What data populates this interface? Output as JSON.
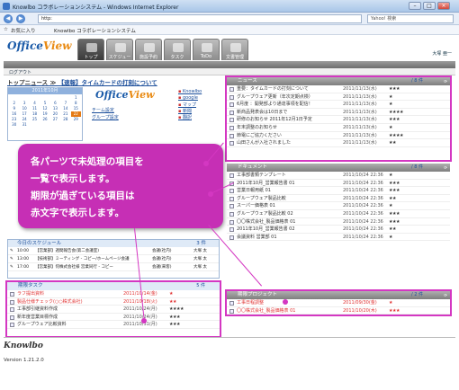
{
  "window": {
    "title": "Knowlbo コラボレーションシステム - Windows Internet Explorer",
    "min": "–",
    "max": "□",
    "close": "×"
  },
  "browser": {
    "url": "http:",
    "search_placeholder": "Yahoo! 検索",
    "favorites_label": "お気に入り",
    "page_tab": "Knowlbo コラボレーションシステム"
  },
  "app": {
    "logo_a": "Office",
    "logo_b": "View",
    "user": "大塚 亜一",
    "tabs": [
      "トップ",
      "スケジュール",
      "施設予約",
      "タスク",
      "ToDo",
      "文書管理"
    ]
  },
  "toolbar": {
    "logout": "ログアウト"
  },
  "news_headline": {
    "prefix": "トップニュース ≫ ",
    "link": "【速報】タイムカードの打刻について"
  },
  "overview": {
    "calendar_title": "2011年10月",
    "calendar_days": [
      "",
      "",
      "",
      "",
      "",
      "",
      "1",
      "2",
      "3",
      "4",
      "5",
      "6",
      "7",
      "8",
      "9",
      "10",
      "11",
      "12",
      "13",
      "14",
      "15",
      "16",
      "17",
      "18",
      "19",
      "20",
      "21",
      "22",
      "23",
      "24",
      "25",
      "26",
      "27",
      "28",
      "29",
      "30",
      "31"
    ],
    "today": "22",
    "links": [
      "Knowlbo",
      "google",
      "マップ",
      "新聞",
      "翻訳"
    ],
    "settings": [
      "チーム設定",
      "グループ設定"
    ]
  },
  "callout": {
    "lines": [
      "各パーツで未処理の項目を",
      "一覧で表示します。",
      "期限が過ぎている項目は",
      "赤文字で表示します。"
    ]
  },
  "news": {
    "title": "ニュース",
    "count": "/ 8 件",
    "rows": [
      {
        "t": "重要：タイムカードの打刻について",
        "d": "2011/11/13(水)",
        "s": "★★★",
        "red": false
      },
      {
        "t": "グループウェア更新（年次定期点検）",
        "d": "2011/11/13(水)",
        "s": "★",
        "red": false
      },
      {
        "t": "6月度 ：開発部より通達事項を配信！",
        "d": "2011/11/13(水)",
        "s": "★",
        "red": false
      },
      {
        "t": "新商品発表会は10日まで",
        "d": "2011/11/13(水)",
        "s": "★★★★",
        "red": false
      },
      {
        "t": "研修のお知らせ 2011年12月1日予定",
        "d": "2011/11/13(水)",
        "s": "★★★",
        "red": false
      },
      {
        "t": "年末調整のお知らせ",
        "d": "2011/11/13(水)",
        "s": "★",
        "red": false
      },
      {
        "t": "節電にご協力ください",
        "d": "2011/11/13(水)",
        "s": "★★★★",
        "red": false
      },
      {
        "t": "山田さんが入社されました",
        "d": "2011/11/13(水)",
        "s": "★★",
        "red": false
      }
    ]
  },
  "documents": {
    "title": "ドキュメント",
    "count": "/ 8 件",
    "rows": [
      {
        "t": "工事部書類テンプレート",
        "d": "2011/10/24 22:36",
        "s": "★",
        "red": false
      },
      {
        "t": "2011年10月_営業報告書 01",
        "d": "2011/10/24 22:36",
        "s": "★★★",
        "red": false
      },
      {
        "t": "営業日報用紙 01",
        "d": "2011/10/24 22:36",
        "s": "★★★",
        "red": false
      },
      {
        "t": "グループウェア製品比較",
        "d": "2011/10/24 22:36",
        "s": "★★",
        "red": false
      },
      {
        "t": "スーパー価格表 01",
        "d": "2011/10/24 22:36",
        "s": "★",
        "red": false
      },
      {
        "t": "グループウェア製品比較 02",
        "d": "2011/10/24 22:36",
        "s": "★★★",
        "red": false
      },
      {
        "t": "〇〇株式会社_製品価格表 01",
        "d": "2011/10/24 22:36",
        "s": "★★★",
        "red": false
      },
      {
        "t": "2011年10月_営業報告書 02",
        "d": "2011/10/24 22:36",
        "s": "★★",
        "red": false
      },
      {
        "t": "会議資料 営業部 01",
        "d": "2011/10/24 22:36",
        "s": "★",
        "red": false
      }
    ]
  },
  "project": {
    "title": "期限プロジェクト",
    "count": "/ 2 件",
    "rows": [
      {
        "t": "工事日程調整",
        "d": "2011/09/30(金)",
        "s": "★",
        "red": true
      },
      {
        "t": "〇〇株式会社_製品価格表 01",
        "d": "2011/10/20(木)",
        "s": "★★★",
        "red": true
      }
    ]
  },
  "schedule": {
    "title": "今日のスケジュール",
    "count": "3 件",
    "rows": [
      {
        "time": "10:00",
        "t": "【営業部】週間報告会(第二会議室)",
        "who": "会議(社内)",
        "who2": "大塚 太"
      },
      {
        "time": "13:00",
        "t": "【技術部】ミーティング - コピー/ホームページ会議",
        "who": "会議(社内)",
        "who2": "大塚 太"
      },
      {
        "time": "17:00",
        "t": "【営業部】何株式会社様 営業同行 - コピー",
        "who": "会議(来客)",
        "who2": "大塚 太"
      }
    ]
  },
  "tasks": {
    "title": "期限タスク",
    "count": "5 件",
    "rows": [
      {
        "t": "ラフ提出資料",
        "d": "2011/10/14(金)",
        "s": "★",
        "red": true
      },
      {
        "t": "製品仕様チェック(○○株式会社)",
        "d": "2011/10/18(火)",
        "s": "★★",
        "red": true
      },
      {
        "t": "工事部引継資料作成",
        "d": "2011/10/24(月)",
        "s": "★★★★",
        "red": false
      },
      {
        "t": "新年度営業目標作成",
        "d": "2011/10/24(月)",
        "s": "★★★",
        "red": false
      },
      {
        "t": "グループウェア比較資料",
        "d": "2011/10/31(月)",
        "s": "★★★",
        "red": false
      }
    ]
  },
  "footer": {
    "brand": "Knowlbo",
    "version": "Version 1.21.2.0"
  },
  "colors": {
    "highlight": "#d437c2",
    "overdue": "#e03030",
    "brand_orange": "#e98a12",
    "brand_blue": "#1a5aa8"
  }
}
